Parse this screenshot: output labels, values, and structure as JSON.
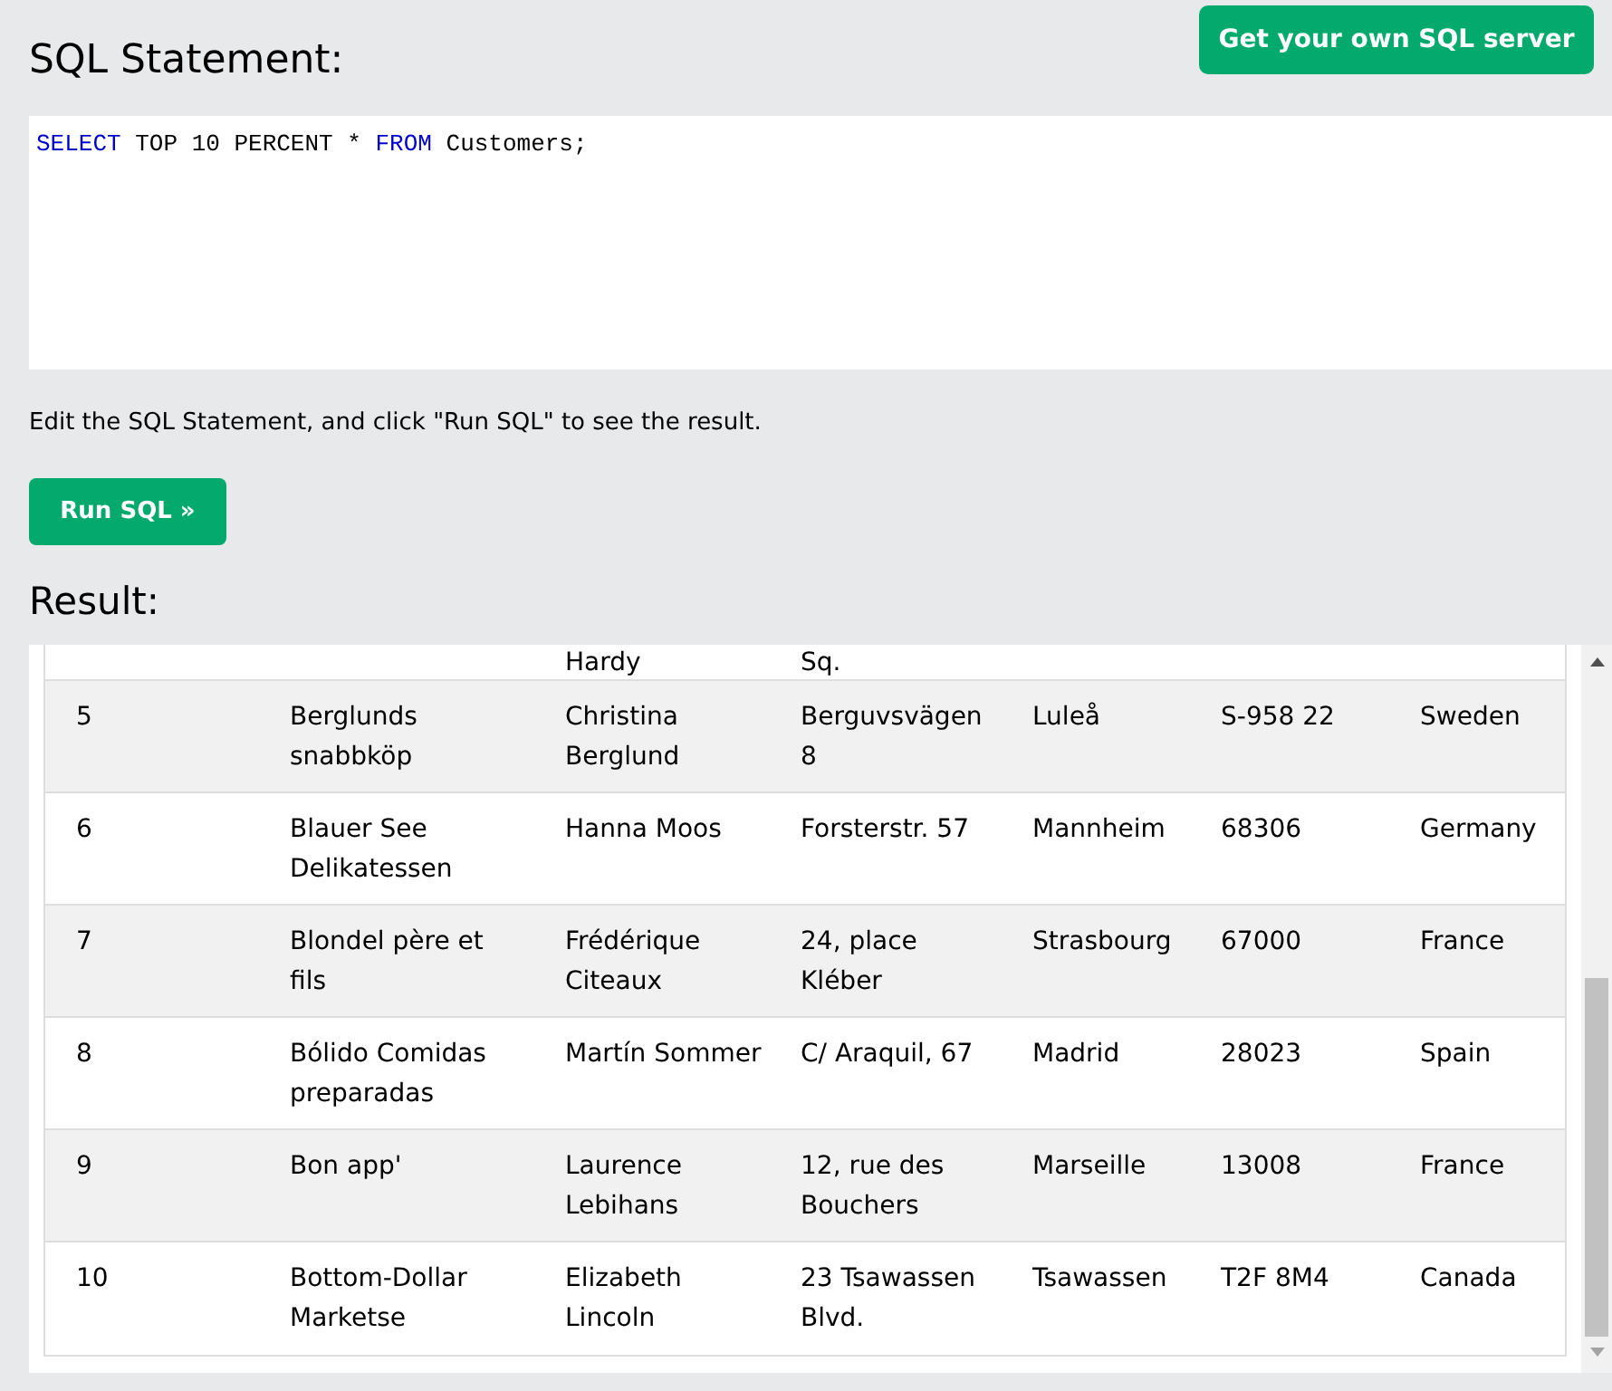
{
  "header": {
    "title": "SQL Statement:",
    "server_button": "Get your own SQL server"
  },
  "editor": {
    "tokens": [
      {
        "text": "SELECT",
        "kind": "keyword"
      },
      {
        "text": " TOP 10 PERCENT * ",
        "kind": "plain"
      },
      {
        "text": "FROM",
        "kind": "keyword"
      },
      {
        "text": " Customers;",
        "kind": "plain"
      }
    ]
  },
  "hint": "Edit the SQL Statement, and click \"Run SQL\" to see the result.",
  "run_button": "Run SQL »",
  "result": {
    "title": "Result:",
    "partial_row": {
      "column_3": "Hardy",
      "column_4": "Sq."
    },
    "rows": [
      [
        "5",
        "Berglunds snabbköp",
        "Christina Berglund",
        "Berguvsvägen 8",
        "Luleå",
        "S-958 22",
        "Sweden"
      ],
      [
        "6",
        "Blauer See Delikatessen",
        "Hanna Moos",
        "Forsterstr. 57",
        "Mannheim",
        "68306",
        "Germany"
      ],
      [
        "7",
        "Blondel père et fils",
        "Frédérique Citeaux",
        "24, place Kléber",
        "Strasbourg",
        "67000",
        "France"
      ],
      [
        "8",
        "Bólido Comidas preparadas",
        "Martín Sommer",
        "C/ Araquil, 67",
        "Madrid",
        "28023",
        "Spain"
      ],
      [
        "9",
        "Bon app'",
        "Laurence Lebihans",
        "12, rue des Bouchers",
        "Marseille",
        "13008",
        "France"
      ],
      [
        "10",
        "Bottom-Dollar Marketse",
        "Elizabeth Lincoln",
        "23 Tsawassen Blvd.",
        "Tsawassen",
        "T2F 8M4",
        "Canada"
      ]
    ]
  }
}
